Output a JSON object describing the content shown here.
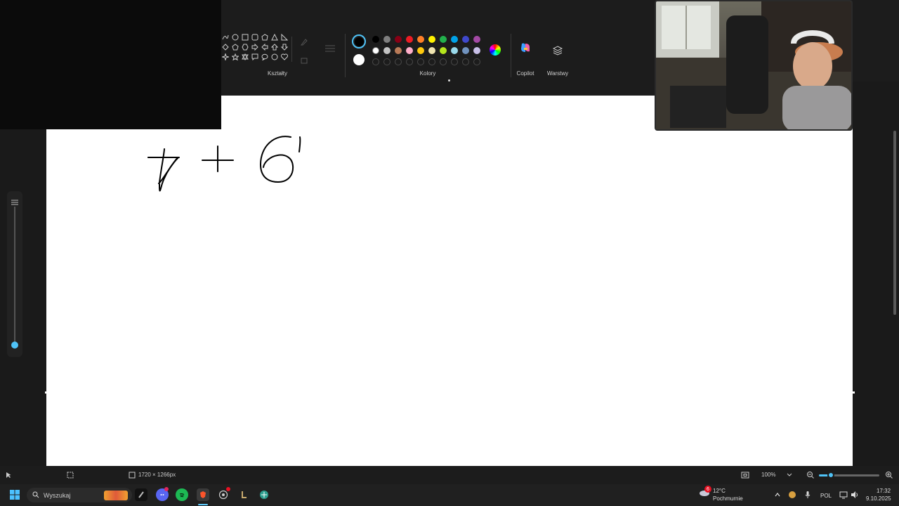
{
  "ribbon": {
    "shapes_label": "Kształty",
    "colors_label": "Kolory",
    "copilot_label": "Copilot",
    "layers_label": "Warstwy",
    "colors": {
      "row1": [
        "#000000",
        "#7f7f7f",
        "#880015",
        "#ed1c24",
        "#ff7f27",
        "#fff200",
        "#22b14c",
        "#00a2e8",
        "#3f48cc",
        "#a349a4"
      ],
      "row2": [
        "#ffffff",
        "#c3c3c3",
        "#b97a57",
        "#ffaec9",
        "#ffc90e",
        "#efe4b0",
        "#b5e61d",
        "#99d9ea",
        "#7092be",
        "#c8bfe7"
      ],
      "primary": "#000000",
      "secondary": "#ffffff"
    }
  },
  "canvas": {
    "drawing_text": "7 + 6"
  },
  "statusbar": {
    "dimensions": "1720 × 1266px",
    "zoom": "100%",
    "zoom_level_fraction": 0.2
  },
  "taskbar": {
    "search_placeholder": "Wyszukaj",
    "weather_temp": "12°C",
    "weather_desc": "Pochmurnie",
    "language": "POL",
    "time": "17:32",
    "date": "9.10.2025",
    "notification_count": "6"
  }
}
